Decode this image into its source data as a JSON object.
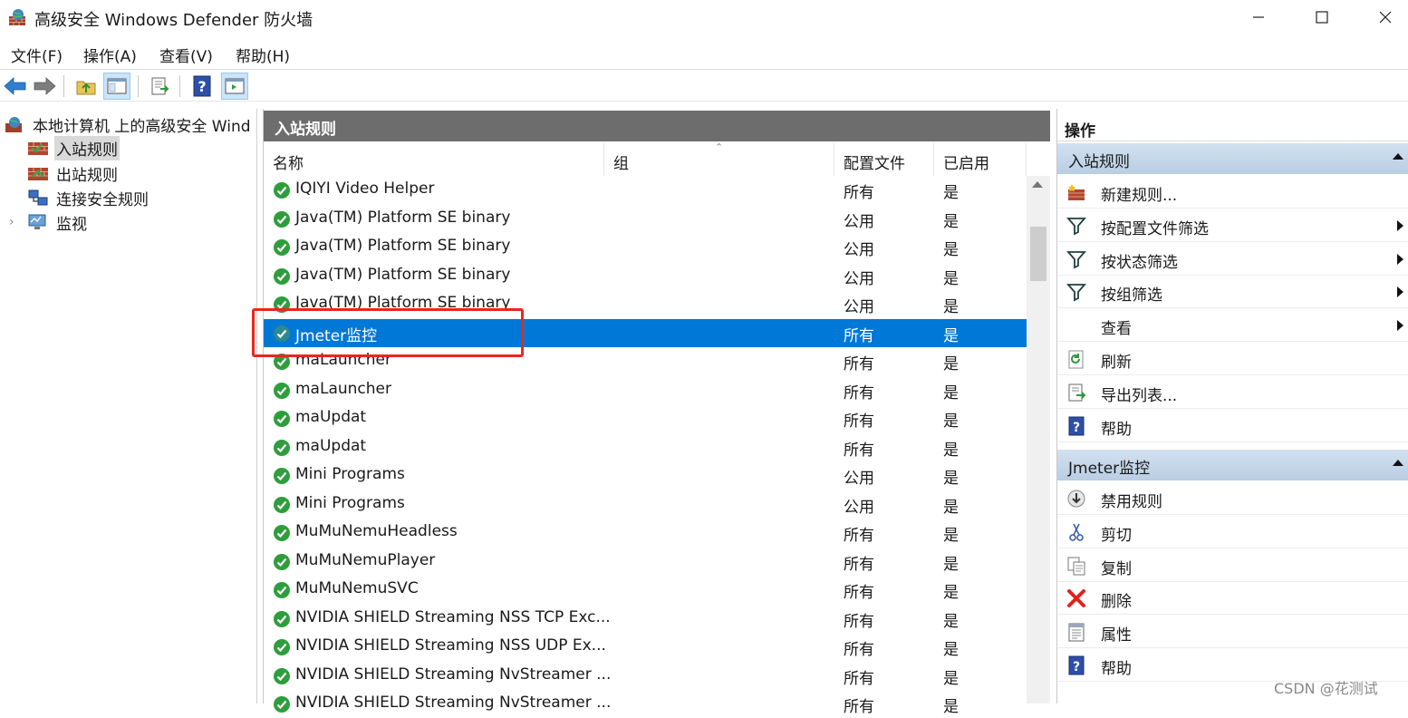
{
  "window": {
    "title": "高级安全 Windows Defender 防火墙"
  },
  "menu": [
    "文件(F)",
    "操作(A)",
    "查看(V)",
    "帮助(H)"
  ],
  "tree": {
    "root": "本地计算机 上的高级安全 Wind",
    "items": [
      "入站规则",
      "出站规则",
      "连接安全规则",
      "监视"
    ],
    "selected": "入站规则"
  },
  "middle": {
    "header": "入站规则",
    "columns": [
      "名称",
      "组",
      "配置文件",
      "已启用"
    ],
    "rows": [
      {
        "name": "IQIYI Video Helper",
        "profile": "所有",
        "enabled": "是"
      },
      {
        "name": "Java(TM) Platform SE binary",
        "profile": "公用",
        "enabled": "是"
      },
      {
        "name": "Java(TM) Platform SE binary",
        "profile": "公用",
        "enabled": "是"
      },
      {
        "name": "Java(TM) Platform SE binary",
        "profile": "公用",
        "enabled": "是"
      },
      {
        "name": "Java(TM) Platform SE binary",
        "profile": "公用",
        "enabled": "是"
      },
      {
        "name": "Jmeter监控",
        "profile": "所有",
        "enabled": "是"
      },
      {
        "name": "maLauncher",
        "profile": "所有",
        "enabled": "是"
      },
      {
        "name": "maLauncher",
        "profile": "所有",
        "enabled": "是"
      },
      {
        "name": "maUpdat",
        "profile": "所有",
        "enabled": "是"
      },
      {
        "name": "maUpdat",
        "profile": "所有",
        "enabled": "是"
      },
      {
        "name": "Mini Programs",
        "profile": "公用",
        "enabled": "是"
      },
      {
        "name": "Mini Programs",
        "profile": "公用",
        "enabled": "是"
      },
      {
        "name": "MuMuNemuHeadless",
        "profile": "所有",
        "enabled": "是"
      },
      {
        "name": "MuMuNemuPlayer",
        "profile": "所有",
        "enabled": "是"
      },
      {
        "name": "MuMuNemuSVC",
        "profile": "所有",
        "enabled": "是"
      },
      {
        "name": "NVIDIA SHIELD Streaming NSS TCP Exc...",
        "profile": "所有",
        "enabled": "是"
      },
      {
        "name": "NVIDIA SHIELD Streaming NSS UDP Ex...",
        "profile": "所有",
        "enabled": "是"
      },
      {
        "name": "NVIDIA SHIELD Streaming NvStreamer ...",
        "profile": "所有",
        "enabled": "是"
      },
      {
        "name": "NVIDIA SHIELD Streaming NvStreamer ...",
        "profile": "所有",
        "enabled": "是"
      }
    ],
    "selected_row": "Jmeter监控"
  },
  "actions": {
    "header": "操作",
    "section1": {
      "title": "入站规则",
      "items": [
        "新建规则...",
        "按配置文件筛选",
        "按状态筛选",
        "按组筛选",
        "查看",
        "刷新",
        "导出列表...",
        "帮助"
      ]
    },
    "section2": {
      "title": "Jmeter监控",
      "items": [
        "禁用规则",
        "剪切",
        "复制",
        "删除",
        "属性",
        "帮助"
      ]
    }
  },
  "watermark": "CSDN @花测试",
  "colors": {
    "selection": "#0078d7",
    "panel_header": "#6d6d6d",
    "section_header": "#c6d7ea",
    "enabled_check": "#2e9e3c",
    "highlight_box": "#e8271f"
  }
}
